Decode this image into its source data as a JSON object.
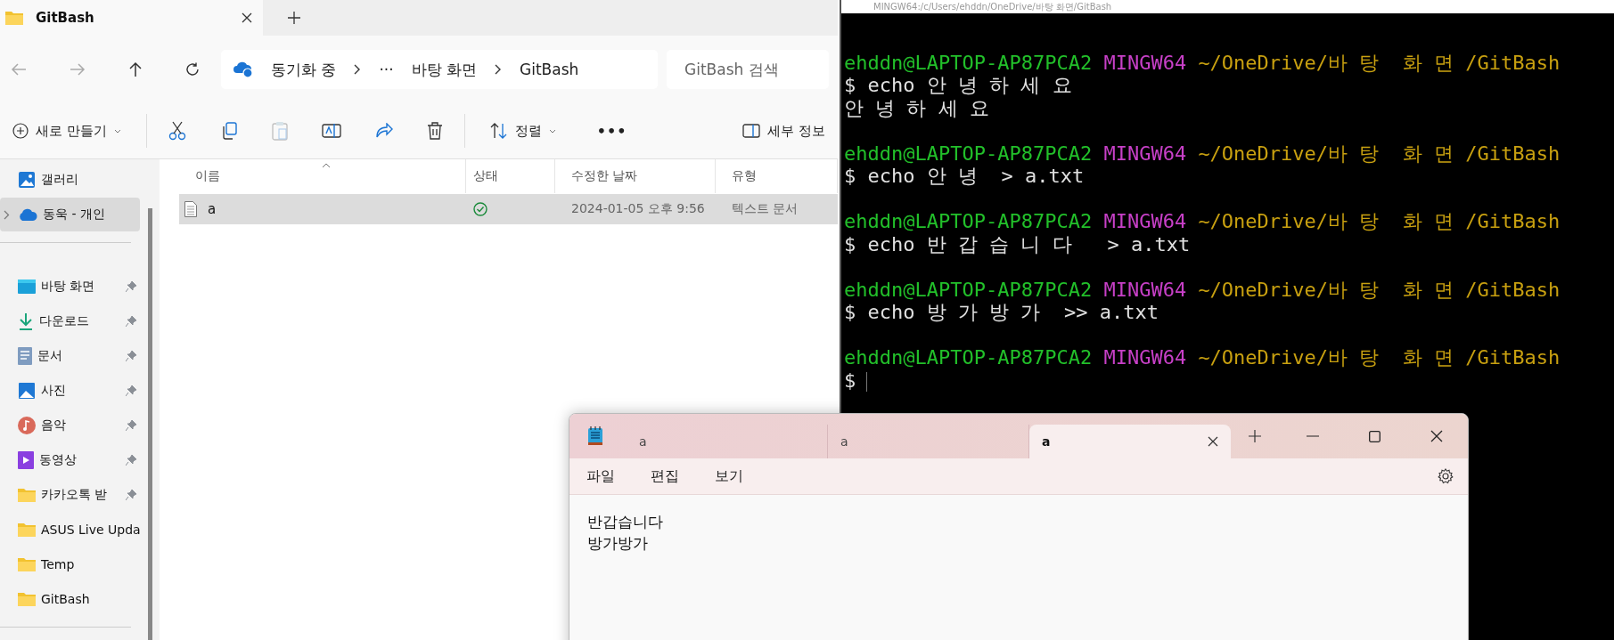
{
  "explorer": {
    "tab": {
      "title": "GitBash"
    },
    "nav": {
      "breadcrumbs": [
        "동기화 중",
        "···",
        "바탕 화면",
        "GitBash"
      ],
      "search": {
        "placeholder": "GitBash 검색"
      }
    },
    "toolbar": {
      "new_label": "새로 만들기",
      "sort_label": "정렬",
      "more": "•••",
      "details_label": "세부 정보",
      "paste_disabled": true
    },
    "sidebar": {
      "top_items": [
        {
          "label": "갤러리",
          "kind": "gallery",
          "selected": false
        },
        {
          "label": "동욱 - 개인",
          "kind": "cloud",
          "selected": true
        }
      ],
      "quick_access": [
        {
          "label": "바탕 화면",
          "kind": "desktop",
          "pinned": true,
          "selected": false
        },
        {
          "label": "다운로드",
          "kind": "download",
          "pinned": true,
          "selected": false
        },
        {
          "label": "문서",
          "kind": "document",
          "pinned": true,
          "selected": false
        },
        {
          "label": "사진",
          "kind": "picture",
          "pinned": true,
          "selected": false
        },
        {
          "label": "음악",
          "kind": "music",
          "pinned": true,
          "selected": false
        },
        {
          "label": "동영상",
          "kind": "video",
          "pinned": true,
          "selected": false
        },
        {
          "label": "카카오톡 받",
          "kind": "folder",
          "pinned": true,
          "selected": false
        },
        {
          "label": "ASUS Live Upda",
          "kind": "folder",
          "pinned": false,
          "selected": false
        },
        {
          "label": "Temp",
          "kind": "folder",
          "pinned": false,
          "selected": false
        },
        {
          "label": "GitBash",
          "kind": "folder",
          "pinned": false,
          "selected": false
        }
      ]
    },
    "table": {
      "columns": [
        "이름",
        "상태",
        "수정한 날짜",
        "유형"
      ],
      "rows": [
        {
          "name": "a",
          "synced": true,
          "modified": "2024-01-05 오후 9:56",
          "type": "텍스트 문서",
          "selected": true
        }
      ]
    }
  },
  "terminal": {
    "title": "MINGW64:/c/Users/ehddn/OneDrive/바탕 화면/GitBash",
    "lines": [
      {
        "kind": "blank"
      },
      {
        "kind": "prompt",
        "user": "ehddn@LAPTOP-AP87PCA2",
        "system": "MINGW64",
        "path": "~/OneDrive/바 탕  화 면 /GitBash"
      },
      {
        "kind": "command",
        "text": "$ echo 안 녕 하 세 요"
      },
      {
        "kind": "output",
        "text": "안 녕 하 세 요"
      },
      {
        "kind": "blank"
      },
      {
        "kind": "prompt",
        "user": "ehddn@LAPTOP-AP87PCA2",
        "system": "MINGW64",
        "path": "~/OneDrive/바 탕  화 면 /GitBash"
      },
      {
        "kind": "command",
        "text": "$ echo 안 녕  > a.txt"
      },
      {
        "kind": "blank"
      },
      {
        "kind": "prompt",
        "user": "ehddn@LAPTOP-AP87PCA2",
        "system": "MINGW64",
        "path": "~/OneDrive/바 탕  화 면 /GitBash"
      },
      {
        "kind": "command",
        "text": "$ echo 반 갑 습 니 다   > a.txt"
      },
      {
        "kind": "blank"
      },
      {
        "kind": "prompt",
        "user": "ehddn@LAPTOP-AP87PCA2",
        "system": "MINGW64",
        "path": "~/OneDrive/바 탕  화 면 /GitBash"
      },
      {
        "kind": "command",
        "text": "$ echo 방 가 방 가  >> a.txt"
      },
      {
        "kind": "blank"
      },
      {
        "kind": "prompt",
        "user": "ehddn@LAPTOP-AP87PCA2",
        "system": "MINGW64",
        "path": "~/OneDrive/바 탕  화 면 /GitBash"
      },
      {
        "kind": "cursor",
        "prompt": "$"
      }
    ]
  },
  "notepad": {
    "tabs": [
      {
        "title": "a",
        "selected": false
      },
      {
        "title": "a",
        "selected": false
      },
      {
        "title": "a",
        "selected": true
      }
    ],
    "menu": [
      "파일",
      "편집",
      "보기"
    ],
    "content": [
      "반갑습니다",
      "방가방가"
    ]
  }
}
